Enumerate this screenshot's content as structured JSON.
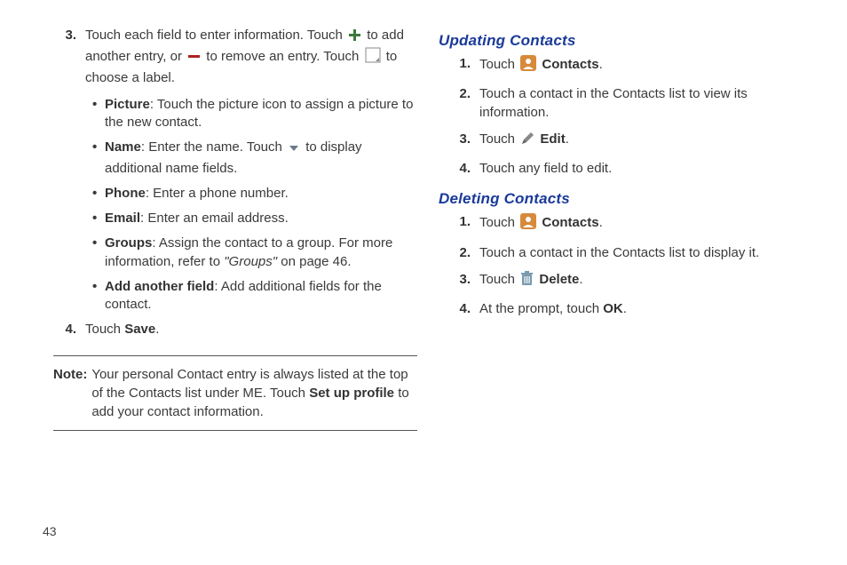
{
  "left": {
    "step3_num": "3.",
    "step3_a": "Touch each field to enter information. Touch ",
    "step3_b": " to add another entry, or ",
    "step3_c": " to remove an entry. Touch ",
    "step3_d": " to choose a label.",
    "bullets": [
      {
        "label": "Picture",
        "text": ": Touch the picture icon to assign a picture to the new contact."
      },
      {
        "label": "Name",
        "pre": ": Enter the name. Touch ",
        "post": " to display additional name fields."
      },
      {
        "label": "Phone",
        "text": ": Enter a phone number."
      },
      {
        "label": "Email",
        "text": ": Enter an email address."
      },
      {
        "label": "Groups",
        "pre": ": Assign the contact to a group. For more information, refer to ",
        "ref": "\"Groups\"",
        "post": " on page 46."
      },
      {
        "label": "Add another field",
        "text": ": Add additional fields for the contact."
      }
    ],
    "step4_num": "4.",
    "step4_a": "Touch ",
    "step4_bold": "Save",
    "step4_b": ".",
    "note_label": "Note:",
    "note_a": " Your personal Contact entry is always listed at the top of the Contacts list under ME. Touch ",
    "note_bold": "Set up profile",
    "note_b": " to add your contact information."
  },
  "right": {
    "heading_update": "Updating Contacts",
    "u1_num": "1.",
    "u1_a": "Touch ",
    "u1_bold": "Contacts",
    "u1_b": ".",
    "u2_num": "2.",
    "u2": "Touch a contact in the Contacts list to view its information.",
    "u3_num": "3.",
    "u3_a": "Touch ",
    "u3_bold": "Edit",
    "u3_b": ".",
    "u4_num": "4.",
    "u4": "Touch any field to edit.",
    "heading_delete": "Deleting Contacts",
    "d1_num": "1.",
    "d1_a": "Touch ",
    "d1_bold": "Contacts",
    "d1_b": ".",
    "d2_num": "2.",
    "d2": "Touch a contact in the Contacts list to display it.",
    "d3_num": "3.",
    "d3_a": "Touch ",
    "d3_bold": "Delete",
    "d3_b": ".",
    "d4_num": "4.",
    "d4_a": "At the prompt, touch ",
    "d4_bold": "OK",
    "d4_b": "."
  },
  "pagenum": "43"
}
